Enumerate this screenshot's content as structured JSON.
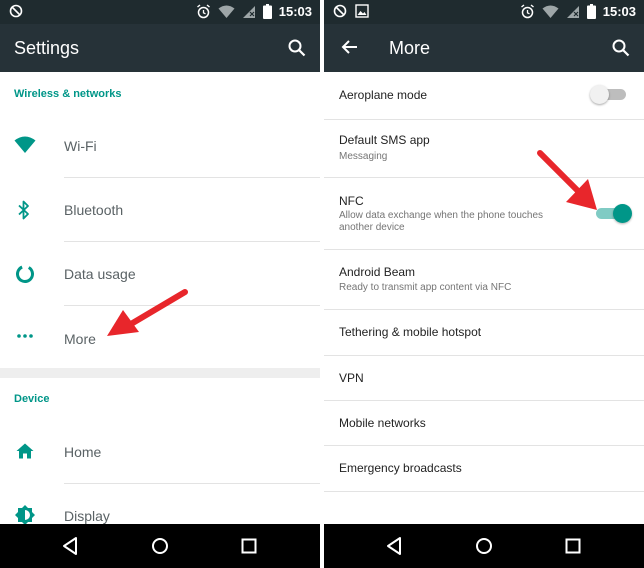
{
  "colors": {
    "accent": "#009688",
    "appbar": "#263238",
    "statusbar": "#1f2b2f",
    "arrow": "#e8262b"
  },
  "left": {
    "status": {
      "time": "15:03",
      "icons": [
        "no-disturb-icon",
        "alarm-icon",
        "wifi-icon",
        "signal-icon",
        "battery-icon"
      ]
    },
    "appbar": {
      "title": "Settings",
      "icons": [
        "search-icon"
      ]
    },
    "sections": [
      {
        "header": "Wireless & networks",
        "items": [
          {
            "label": "Wi-Fi",
            "icon": "wifi-icon"
          },
          {
            "label": "Bluetooth",
            "icon": "bluetooth-icon"
          },
          {
            "label": "Data usage",
            "icon": "data-usage-icon"
          },
          {
            "label": "More",
            "icon": "more-dots-icon"
          }
        ]
      },
      {
        "header": "Device",
        "items": [
          {
            "label": "Home",
            "icon": "home-icon"
          },
          {
            "label": "Display",
            "icon": "display-icon"
          }
        ]
      }
    ],
    "navbar": [
      "back-icon",
      "home-circle-icon",
      "recents-icon"
    ]
  },
  "right": {
    "status": {
      "time": "15:03",
      "icons": [
        "no-disturb-icon",
        "image-icon",
        "alarm-icon",
        "wifi-icon",
        "signal-icon",
        "battery-icon"
      ]
    },
    "appbar": {
      "title": "More",
      "icons": [
        "back-arrow-icon",
        "search-icon"
      ]
    },
    "items": [
      {
        "title": "Aeroplane mode",
        "subtitle": "",
        "switch": false
      },
      {
        "title": "Default SMS app",
        "subtitle": "Messaging"
      },
      {
        "title": "NFC",
        "subtitle": "Allow data exchange when the phone touches another device",
        "switch": true
      },
      {
        "title": "Android Beam",
        "subtitle": "Ready to transmit app content via NFC"
      },
      {
        "title": "Tethering & mobile hotspot",
        "subtitle": ""
      },
      {
        "title": "VPN",
        "subtitle": ""
      },
      {
        "title": "Mobile networks",
        "subtitle": ""
      },
      {
        "title": "Emergency broadcasts",
        "subtitle": ""
      }
    ],
    "navbar": [
      "back-icon",
      "home-circle-icon",
      "recents-icon"
    ]
  }
}
